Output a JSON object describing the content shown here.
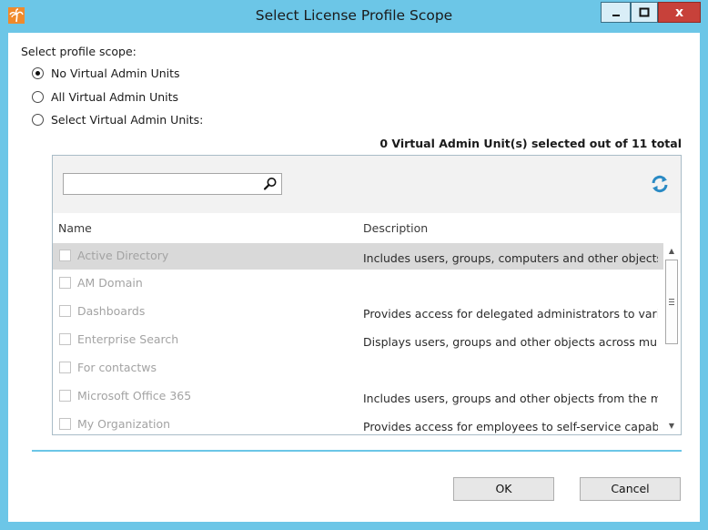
{
  "window": {
    "title": "Select License Profile Scope",
    "close_glyph": "x",
    "accent_color": "#6cc6e7"
  },
  "scope": {
    "label": "Select profile scope:",
    "options": [
      {
        "label": "No Virtual Admin Units",
        "checked": true
      },
      {
        "label": "All Virtual Admin Units",
        "checked": false
      },
      {
        "label": "Select Virtual Admin Units:",
        "checked": false
      }
    ]
  },
  "summary": "0 Virtual Admin Unit(s) selected out of 11 total",
  "search": {
    "value": "",
    "placeholder": ""
  },
  "columns": {
    "name": "Name",
    "description": "Description"
  },
  "rows": [
    {
      "name": "Active Directory",
      "description": "Includes users, groups, computers and other objects from"
    },
    {
      "name": "AM Domain",
      "description": ""
    },
    {
      "name": "Dashboards",
      "description": "Provides access for delegated administrators to various"
    },
    {
      "name": "Enterprise Search",
      "description": "Displays users, groups and other objects across multiple"
    },
    {
      "name": "For contactws",
      "description": ""
    },
    {
      "name": "Microsoft Office 365",
      "description": "Includes users, groups and other objects from the many"
    },
    {
      "name": "My Organization",
      "description": "Provides access for employees to self-service capabilities"
    }
  ],
  "buttons": {
    "ok": "OK",
    "cancel": "Cancel"
  },
  "icons": {
    "app": "palm-tree-icon",
    "minimize": "minimize-icon",
    "maximize": "maximize-icon",
    "close": "close-icon",
    "search": "magnifier-icon",
    "refresh": "refresh-icon"
  }
}
